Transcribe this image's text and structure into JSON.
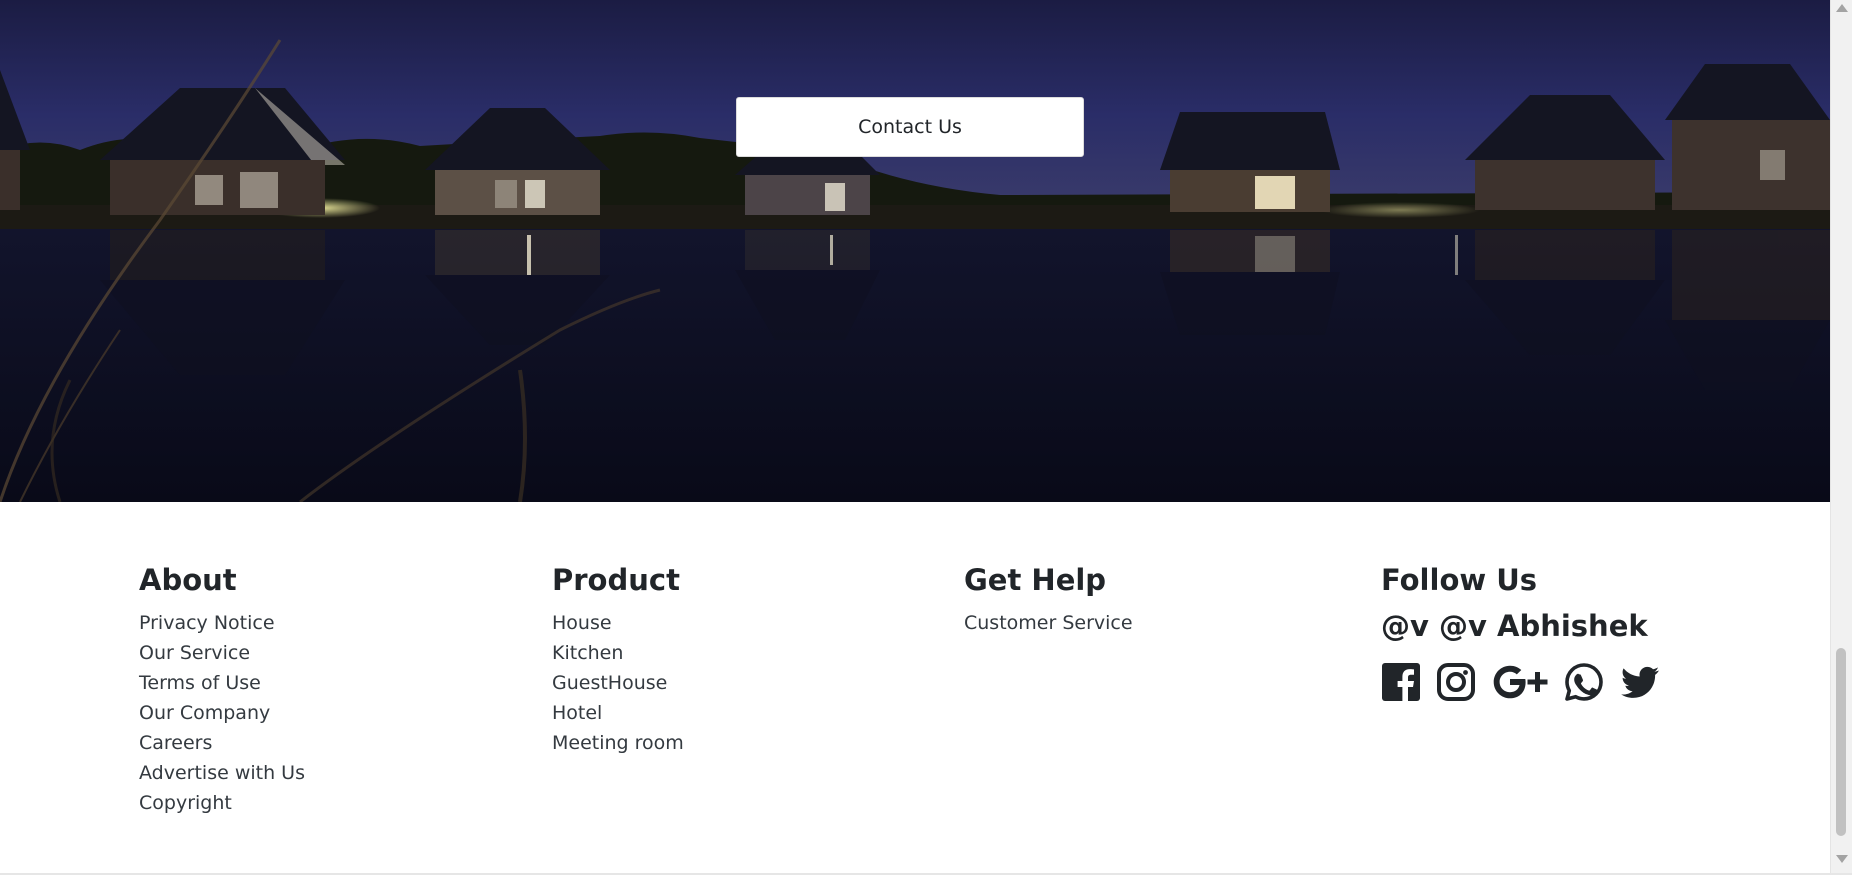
{
  "hero": {
    "contact_button_label": "Contact Us"
  },
  "footer": {
    "about": {
      "title": "About",
      "links": [
        "Privacy Notice",
        "Our Service",
        "Terms of Use",
        "Our Company",
        "Careers",
        "Advertise with Us",
        "Copyright"
      ]
    },
    "product": {
      "title": "Product",
      "links": [
        "House",
        "Kitchen",
        "GuestHouse",
        "Hotel",
        "Meeting room"
      ]
    },
    "get_help": {
      "title": "Get Help",
      "links": [
        "Customer Service"
      ]
    },
    "follow_us": {
      "title": "Follow Us",
      "handle": "@v @v Abhishek",
      "social_icons": [
        "facebook-icon",
        "instagram-icon",
        "google-plus-icon",
        "whatsapp-icon",
        "twitter-icon"
      ]
    }
  },
  "colors": {
    "icon_color": "#212529",
    "night_sky": "#1d1f45",
    "water": "#0a0c1c"
  }
}
